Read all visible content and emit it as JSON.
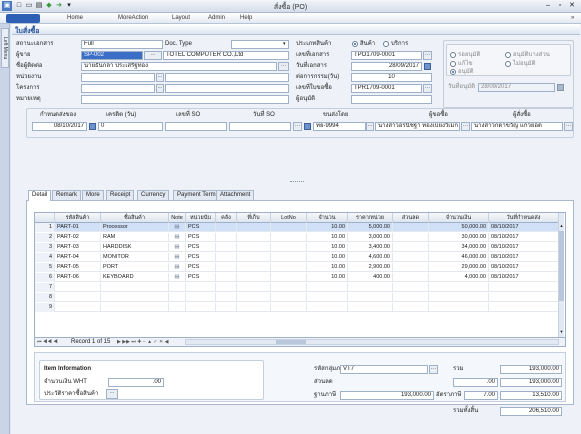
{
  "window": {
    "title": "สั่งซื้อ (PO)"
  },
  "menu": [
    "Home",
    "MoreAction",
    "Layout",
    "Admin",
    "Help"
  ],
  "left_tab": "Left Menu",
  "panel_title": "ใบสั่งซื้อ",
  "header_left": {
    "status_label": "สถานะเอกสาร",
    "status_value": "Full",
    "doctype_label": "Doc. Type",
    "doctype_value": "",
    "vendor_label": "ผู้ขาย",
    "vendor_code": "SP-002",
    "vendor_name": "TOTEL COMPUTER CO.,Ltd",
    "contact_label": "ชื่อผู้ติดต่อ",
    "contact_value": "นายธันกล้า ประเสริฐทอง",
    "dept_label": "หน่วยงาน",
    "project_label": "โครงการ",
    "note_label": "หมายเหตุ"
  },
  "header_mid": {
    "goods_type_label": "ประเภทสินค้า",
    "goods_opt1": "สินค้า",
    "goods_opt2": "บริการ",
    "docno_label": "เลขที่เอกสาร",
    "docno_value": "TPO1709-0001",
    "docdate_label": "วันที่เอกสาร",
    "docdate_value": "28/09/2017",
    "pay_label": "ต่อการกรรม(วัน)",
    "pay_value": "10",
    "pr_label": "เลขที่ใบขอซื้อ",
    "pr_value": "TPR1709-0001",
    "approver_label": "ผู้อนุมัติ",
    "approver_value": ""
  },
  "header_right": {
    "opt_a": "รออนุมัติ",
    "opt_b": "อนุมัติบางส่วน",
    "opt_c": "แก้ไข",
    "opt_d": "ไม่อนุมัติ",
    "opt_e": "อนุมัติ",
    "approve_date_label": "วันที่อนุมัติ",
    "approve_date_value": "28/09/2017"
  },
  "row2": {
    "headers": [
      "กำหนดส่งของ",
      "เครดิต (วัน)",
      "เลขที่ SO",
      "วันที่ SO",
      "ขนส่งโดย",
      "ผู้ขอซื้อ",
      "ผู้สั่งซื้อ"
    ],
    "due_date": "08/10/2017",
    "credit": "0",
    "so_no": "",
    "so_date": "",
    "ship_by": "ทย-9994",
    "requester": "นางสาวอรนิชฐา ทองเบี้ยงวิเมก",
    "buyer": "นางสาวกดาขวัญ แก้วยอด"
  },
  "tabs": [
    "Detail",
    "Remark",
    "More",
    "Receipt",
    "Currency",
    "Payment Term",
    "Attachment"
  ],
  "grid": {
    "headers": [
      "รหัสสินค้า",
      "ชื่อสินค้า",
      "Note",
      "หน่วยนับ",
      "คลัง",
      "ที่เก็บ",
      "LotNo",
      "จำนวน",
      "ราคา/หน่วย",
      "ส่วนลด",
      "จำนวนเงิน",
      "วันที่กำหนดส่ง"
    ],
    "rows": [
      {
        "no": "1",
        "code": "PART-01",
        "name": "Processor",
        "unit": "PCS",
        "qty": "10.00",
        "price": "5,000.00",
        "disc": "",
        "amount": "50,000.00",
        "date": "08/10/2017"
      },
      {
        "no": "2",
        "code": "PART-02",
        "name": "RAM",
        "unit": "PCS",
        "qty": "10.00",
        "price": "3,000.00",
        "disc": "",
        "amount": "30,000.00",
        "date": "08/10/2017"
      },
      {
        "no": "3",
        "code": "PART-03",
        "name": "HARDDISK",
        "unit": "PCS",
        "qty": "10.00",
        "price": "3,400.00",
        "disc": "",
        "amount": "34,000.00",
        "date": "08/10/2017"
      },
      {
        "no": "4",
        "code": "PART-04",
        "name": "MONITOR",
        "unit": "PCS",
        "qty": "10.00",
        "price": "4,600.00",
        "disc": "",
        "amount": "46,000.00",
        "date": "08/10/2017"
      },
      {
        "no": "5",
        "code": "PART-05",
        "name": "PORT",
        "unit": "PCS",
        "qty": "10.00",
        "price": "2,900.00",
        "disc": "",
        "amount": "29,000.00",
        "date": "08/10/2017"
      },
      {
        "no": "6",
        "code": "PART-06",
        "name": "KEYBOARD",
        "unit": "PCS",
        "qty": "10.00",
        "price": "400.00",
        "disc": "",
        "amount": "4,000.00",
        "date": "08/10/2017"
      },
      {
        "no": "7"
      },
      {
        "no": "8"
      },
      {
        "no": "9"
      }
    ],
    "record_text": "Record 1 of 15"
  },
  "bottom": {
    "item_info": "Item Information",
    "wht_label": "จำนวนเงิน WHT",
    "wht_value": ".00",
    "history_label": "ประวัติราคาซื้อสินค้า",
    "taxgroup_label": "รหัสกลุ่มภาษี",
    "taxgroup_value": "VT7",
    "discount_label": "ส่วนลด",
    "taxbase_label": "ฐานภาษี",
    "taxbase_value": "193,000.00",
    "total_label": "รวม",
    "total_value": "193,000.00",
    "disc_pct": ".00",
    "after_disc": "193,000.00",
    "rate_label": "อัตราภาษี",
    "rate_value": "7.00",
    "vat_value": "13,510.00",
    "grand_label": "รวมทั้งสิ้น",
    "grand_value": "206,510.00"
  }
}
